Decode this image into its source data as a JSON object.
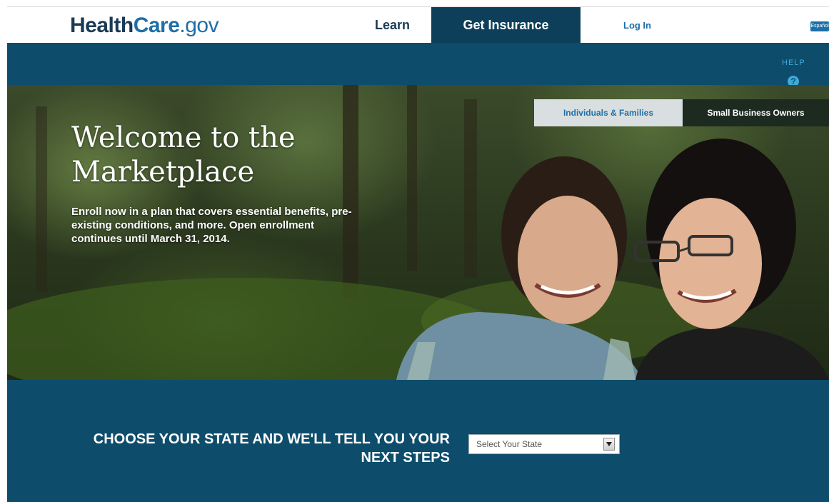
{
  "header": {
    "logo": {
      "health": "Health",
      "care": "Care",
      "gov": ".gov"
    },
    "nav": {
      "learn": "Learn",
      "get_insurance": "Get Insurance",
      "login": "Log In",
      "language": "Español"
    }
  },
  "help": {
    "label": "HELP",
    "icon_glyph": "?"
  },
  "hero": {
    "title": "Welcome to the Marketplace",
    "text": "Enroll now in a plan that covers essential benefits, pre-existing conditions, and more. Open enrollment continues until March 31, 2014.",
    "tabs": [
      "Individuals & Families",
      "Small Business Owners"
    ]
  },
  "chooser": {
    "prompt": "CHOOSE YOUR STATE AND WE'LL TELL YOU YOUR NEXT STEPS",
    "select_value": "Select Your State"
  },
  "colors": {
    "brand_dark": "#0d4d6b",
    "nav_active": "#0d3f5a",
    "brand_blue": "#1d6fa8",
    "help_blue": "#3fa9d8"
  },
  "icons": [
    "help-icon",
    "chevron-down-icon"
  ]
}
